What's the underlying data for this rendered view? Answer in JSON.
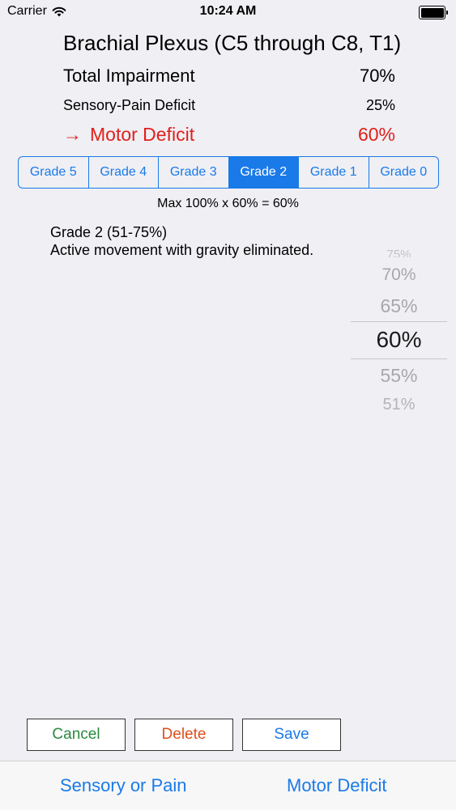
{
  "status_bar": {
    "carrier": "Carrier",
    "time": "10:24 AM",
    "wifi_icon": "wifi-icon",
    "battery_icon": "battery-icon"
  },
  "header": {
    "title": "Brachial Plexus (C5 through C8, T1)"
  },
  "summary": {
    "total_label": "Total Impairment",
    "total_value": "70%",
    "sensory_label": "Sensory-Pain Deficit",
    "sensory_value": "25%",
    "motor_arrow": "→",
    "motor_label": "Motor Deficit",
    "motor_value": "60%",
    "motor_color": "#e0201b"
  },
  "grades": {
    "segments": [
      "Grade 5",
      "Grade 4",
      "Grade 3",
      "Grade 2",
      "Grade 1",
      "Grade 0"
    ],
    "selected": "Grade 2",
    "accent_color": "#1a7ae8"
  },
  "formula": "Max 100% x 60% = 60%",
  "grade_info": {
    "title": "Grade 2 (51-75%)",
    "description": "Active movement with gravity eliminated."
  },
  "picker": {
    "options": [
      "75%",
      "70%",
      "65%",
      "60%",
      "55%",
      "51%"
    ],
    "selected": "60%"
  },
  "buttons": {
    "cancel": "Cancel",
    "delete": "Delete",
    "save": "Save"
  },
  "tabs": {
    "sensory": "Sensory or Pain",
    "motor": "Motor Deficit"
  }
}
